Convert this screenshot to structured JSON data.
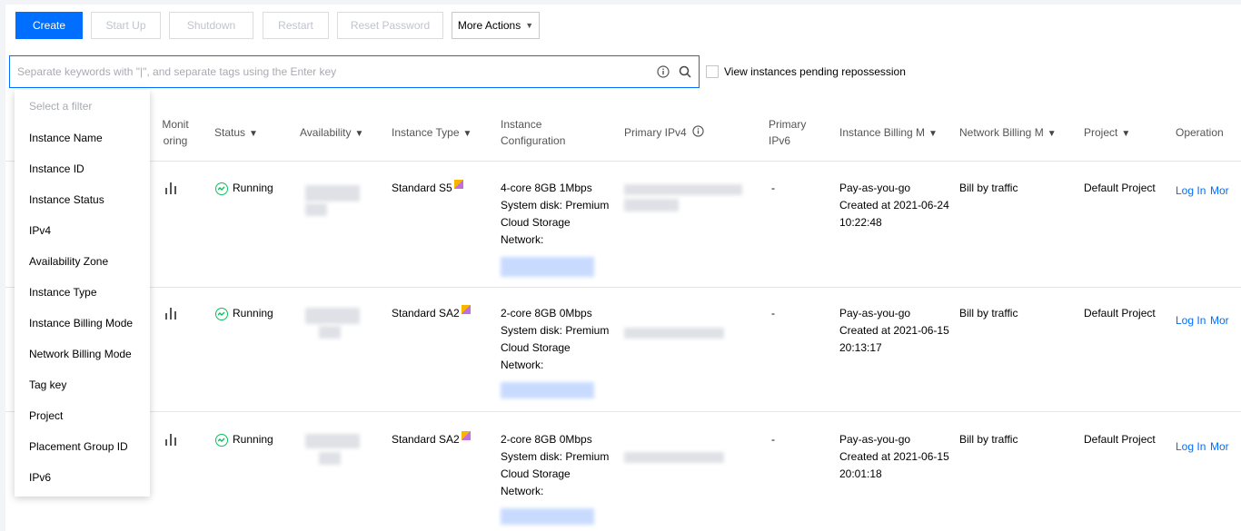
{
  "toolbar": {
    "create": "Create",
    "start_up": "Start Up",
    "shutdown": "Shutdown",
    "restart": "Restart",
    "reset_password": "Reset Password",
    "more_actions": "More Actions"
  },
  "search": {
    "placeholder": "Separate keywords with \"|\", and separate tags using the Enter key",
    "info_icon": "info-circle-icon",
    "search_icon": "magnifier-icon"
  },
  "repossession": {
    "label": "View instances pending repossession",
    "checked": false
  },
  "table": {
    "headers": {
      "monitoring_1": "Monit",
      "monitoring_2": "oring",
      "status": "Status",
      "availability": "Availability",
      "instance_type": "Instance Type",
      "config_1": "Instance",
      "config_2": "Configuration",
      "ipv4": "Primary IPv4",
      "ipv6_1": "Primary",
      "ipv6_2": "IPv6",
      "billing": "Instance Billing M",
      "network_billing": "Network Billing M",
      "project": "Project",
      "operation": "Operation"
    },
    "rows": [
      {
        "status": "Running",
        "instance_type": "Standard S5",
        "config": [
          "4-core 8GB 1Mbps",
          "System disk: Premium",
          "Cloud Storage",
          "Network:"
        ],
        "ipv6": "-",
        "billing": [
          "Pay-as-you-go",
          "Created at 2021-06-24",
          "10:22:48"
        ],
        "network_billing": "Bill by traffic",
        "project": "Default Project",
        "op_login": "Log In",
        "op_more": "Mor"
      },
      {
        "status": "Running",
        "instance_type": "Standard SA2",
        "config": [
          "2-core 8GB 0Mbps",
          "System disk: Premium",
          "Cloud Storage",
          "Network:"
        ],
        "ipv6": "-",
        "billing": [
          "Pay-as-you-go",
          "Created at 2021-06-15",
          "20:13:17"
        ],
        "network_billing": "Bill by traffic",
        "project": "Default Project",
        "op_login": "Log In",
        "op_more": "Mor"
      },
      {
        "status": "Running",
        "instance_type": "Standard SA2",
        "config": [
          "2-core 8GB 0Mbps",
          "System disk: Premium",
          "Cloud Storage",
          "Network:"
        ],
        "ipv6": "-",
        "billing": [
          "Pay-as-you-go",
          "Created at 2021-06-15",
          "20:01:18"
        ],
        "network_billing": "Bill by traffic",
        "project": "Default Project",
        "op_login": "Log In",
        "op_more": "Mor"
      }
    ]
  },
  "filter_dropdown": {
    "hint": "Select a filter",
    "items": [
      "Instance Name",
      "Instance ID",
      "Instance Status",
      "IPv4",
      "Availability Zone",
      "Instance Type",
      "Instance Billing Mode",
      "Network Billing Mode",
      "Tag key",
      "Project",
      "Placement Group ID",
      "IPv6"
    ]
  },
  "colors": {
    "primary": "#006eff",
    "success": "#0abf5b"
  }
}
